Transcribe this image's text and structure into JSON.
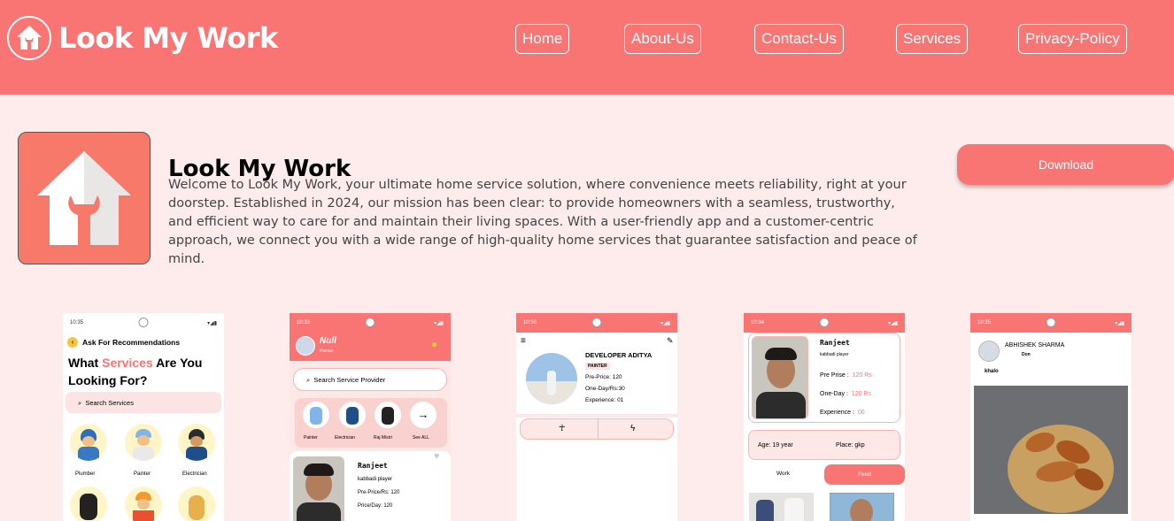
{
  "header": {
    "brand": "Look My Work",
    "nav": [
      "Home",
      "About-Us",
      "Contact-Us",
      "Services",
      "Privacy-Policy"
    ]
  },
  "about": {
    "title": "Look My Work",
    "text": "Welcome to Look My Work, your ultimate home service solution, where convenience meets reliability, right at your doorstep. Established in 2024, our mission has been clear: to provide homeowners with a seamless, trustworthy, and efficient way to care for and maintain their living spaces. With a user-friendly app and a customer-centric approach, we connect you with a wide range of high-quality home services that guarantee satisfaction and peace of mind.",
    "download_label": "Download"
  },
  "colors": {
    "brand": "#f87574",
    "background": "#fdeceb"
  },
  "phones": {
    "p1": {
      "time": "10:35",
      "ask": "Ask For Recommendations",
      "heading_a": "What ",
      "heading_b": "Services",
      "heading_c": " Are You",
      "heading_d": "Looking For?",
      "search": "Search Services",
      "services": [
        "Plumber",
        "Painter",
        "Electrician"
      ]
    },
    "p2": {
      "time": "10:33",
      "user": "Null",
      "role": "Painter",
      "search": "Search Service Provider",
      "categories": [
        "Painter",
        "Electrician",
        "Raj Mistri",
        "See ALL"
      ],
      "name": "Ranjeet",
      "skill": "kabbadi player",
      "price": "Pre-Price/Rs:   120",
      "day": "Price/Day:   120"
    },
    "p3": {
      "time": "10:36",
      "name": "DEVELOPER ADITYA",
      "role": "PAINTER",
      "price": "Pre-Price: 120",
      "day": "One-Day/Rs:30",
      "exp": "Experience: 01"
    },
    "p4": {
      "time": "10:34",
      "name": "Ranjeet",
      "skill": "kabbadi player",
      "price_label": "Pre Prise :",
      "price_val": "120 Rs",
      "day_label": "One-Day :",
      "day_val": "120 Rs",
      "exp_label": "Experience :",
      "exp_val": "00",
      "age": "Age: 19 year",
      "place": "Place: gkp",
      "tab_work": "Work",
      "tab_feed": "Feed"
    },
    "p5": {
      "time": "10:35",
      "name": "ABHISHEK SHARMA",
      "sub": "Don",
      "caption": "khalo"
    }
  }
}
